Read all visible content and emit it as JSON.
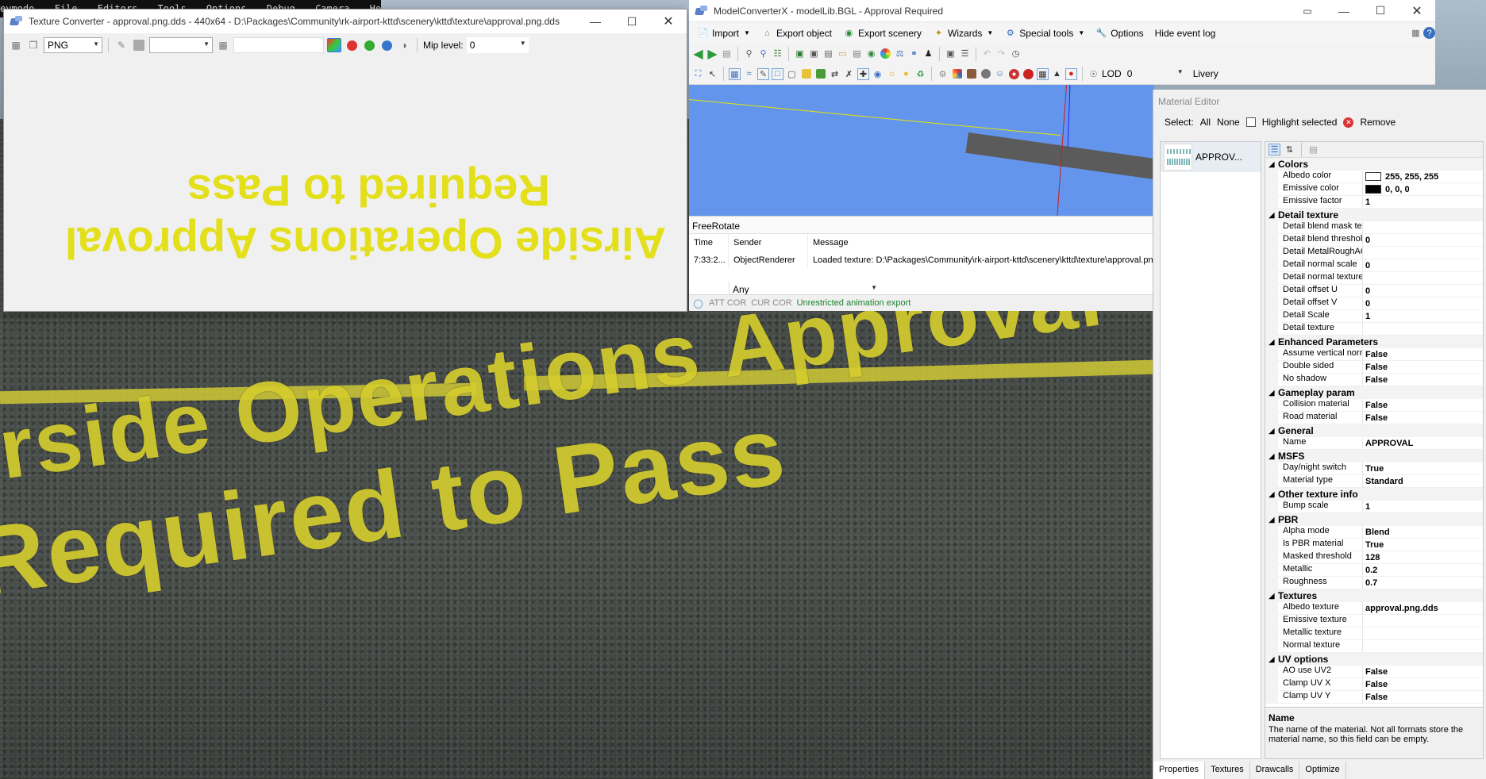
{
  "background": {
    "menubar": [
      "eymodo",
      "File",
      "Editors",
      "Tools",
      "Options",
      "Debug",
      "Camera",
      "Help"
    ],
    "paint_line1": "Airside Operations Approval",
    "paint_line2": "Required to Pass",
    "paint_color": "#d4cc2e"
  },
  "texture_converter": {
    "title": "Texture Converter - approval.png.dds - 440x64 - D:\\Packages\\Community\\rk-airport-kttd\\scenery\\kttd\\texture\\approval.png.dds",
    "format": "PNG",
    "mip_label": "Mip level:",
    "mip_value": "0",
    "texture_line1": "Airside Operations Approval",
    "texture_line2": "Required to Pass",
    "texture_color": "#e3df1a"
  },
  "mcx": {
    "title": "ModelConverterX - modelLib.BGL - Approval Required",
    "menu": {
      "import": "Import",
      "export_object": "Export object",
      "export_scenery": "Export scenery",
      "wizards": "Wizards",
      "special_tools": "Special tools",
      "options": "Options",
      "hide_event_log": "Hide event log"
    },
    "toolbar2": {
      "lod_label": "LOD",
      "lod_value": "0",
      "livery_label": "Livery"
    },
    "event_log": {
      "panel_title": "FreeRotate",
      "headers": [
        "Time",
        "Sender",
        "Message"
      ],
      "rows": [
        [
          "7:33:2...",
          "ObjectRenderer",
          "Loaded texture: D:\\Packages\\Community\\rk-airport-kttd\\scenery\\kttd\\texture\\approval.png.dds"
        ]
      ],
      "filter": "Any"
    },
    "status": {
      "att": "ATT COR",
      "cur": "CUR COR",
      "message": "Unrestricted animation export"
    }
  },
  "material_editor": {
    "title": "Material Editor",
    "select_label": "Select:",
    "all": "All",
    "none": "None",
    "highlight": "Highlight selected",
    "remove": "Remove",
    "materials": [
      "APPROV..."
    ],
    "categories": [
      {
        "name": "Colors",
        "props": [
          {
            "k": "Albedo color",
            "v": "255, 255, 255",
            "swatch": "#ffffff"
          },
          {
            "k": "Emissive color",
            "v": "0, 0, 0",
            "swatch": "#000000"
          },
          {
            "k": "Emissive factor",
            "v": "1"
          }
        ]
      },
      {
        "name": "Detail texture",
        "props": [
          {
            "k": "Detail blend mask text",
            "v": ""
          },
          {
            "k": "Detail blend threshold",
            "v": "0"
          },
          {
            "k": "Detail MetalRoughAO",
            "v": ""
          },
          {
            "k": "Detail normal scale",
            "v": "0"
          },
          {
            "k": "Detail normal texture",
            "v": ""
          },
          {
            "k": "Detail offset U",
            "v": "0"
          },
          {
            "k": "Detail offset V",
            "v": "0"
          },
          {
            "k": "Detail Scale",
            "v": "1"
          },
          {
            "k": "Detail texture",
            "v": ""
          }
        ]
      },
      {
        "name": "Enhanced Parameters",
        "props": [
          {
            "k": "Assume vertical norma",
            "v": "False"
          },
          {
            "k": "Double sided",
            "v": "False"
          },
          {
            "k": "No shadow",
            "v": "False"
          }
        ]
      },
      {
        "name": "Gameplay param",
        "props": [
          {
            "k": "Collision material",
            "v": "False"
          },
          {
            "k": "Road material",
            "v": "False"
          }
        ]
      },
      {
        "name": "General",
        "props": [
          {
            "k": "Name",
            "v": "APPROVAL"
          }
        ]
      },
      {
        "name": "MSFS",
        "props": [
          {
            "k": "Day/night switch",
            "v": "True"
          },
          {
            "k": "Material type",
            "v": "Standard"
          }
        ]
      },
      {
        "name": "Other texture info",
        "props": [
          {
            "k": "Bump scale",
            "v": "1"
          }
        ]
      },
      {
        "name": "PBR",
        "props": [
          {
            "k": "Alpha mode",
            "v": "Blend"
          },
          {
            "k": "Is PBR material",
            "v": "True"
          },
          {
            "k": "Masked threshold",
            "v": "128"
          },
          {
            "k": "Metallic",
            "v": "0.2"
          },
          {
            "k": "Roughness",
            "v": "0.7"
          }
        ]
      },
      {
        "name": "Textures",
        "props": [
          {
            "k": "Albedo texture",
            "v": "approval.png.dds"
          },
          {
            "k": "Emissive texture",
            "v": ""
          },
          {
            "k": "Metallic texture",
            "v": ""
          },
          {
            "k": "Normal texture",
            "v": ""
          }
        ]
      },
      {
        "name": "UV options",
        "props": [
          {
            "k": "AO use UV2",
            "v": "False"
          },
          {
            "k": "Clamp UV X",
            "v": "False"
          },
          {
            "k": "Clamp UV Y",
            "v": "False"
          }
        ]
      }
    ],
    "description_title": "Name",
    "description_text": "The name of the material. Not all formats store the material name, so this field can be empty.",
    "tabs": [
      "Properties",
      "Textures",
      "Drawcalls",
      "Optimize"
    ]
  }
}
